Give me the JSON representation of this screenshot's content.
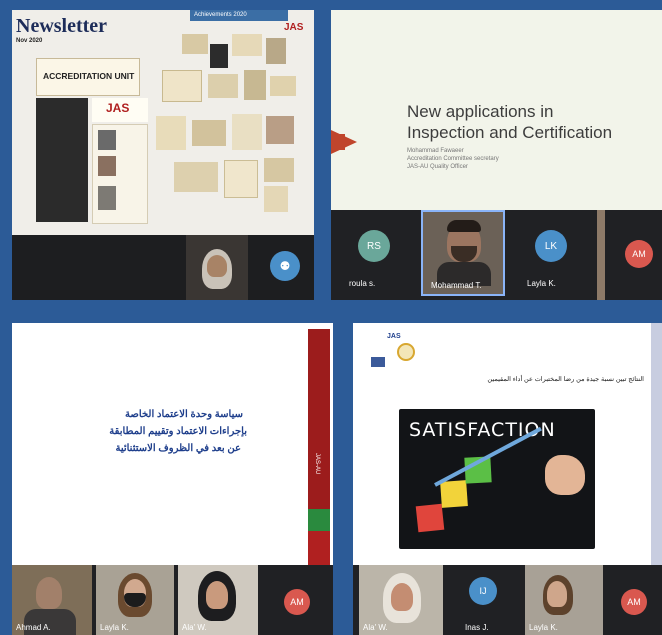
{
  "p1": {
    "title": "Newsletter",
    "subtitle": "Nov 2020",
    "unit": "ACCREDITATION UNIT",
    "logo": "JAS",
    "top_bar_text": "Achievements 2020",
    "logo2": "JAS"
  },
  "p2": {
    "title_line1": "New applications in",
    "title_line2": "Inspection and Certification",
    "sub1": "Mohammad Fawaeer",
    "sub2": "Accreditation Committee secretary",
    "sub3": "JAS-AU Quality Officer",
    "participants": [
      {
        "initials": "RS",
        "name": "roula s."
      },
      {
        "initials": "",
        "name": "Mohammad T."
      },
      {
        "initials": "LK",
        "name": "Layla K."
      },
      {
        "initials": "AM",
        "name": ""
      }
    ]
  },
  "p3": {
    "line1": "سياسة وحدة الاعتماد الخاصة",
    "line2": "بإجراءات الاعتماد وتقييم المطابقة",
    "line3": "عن بعد في الظروف الاستثنائية",
    "side_label": "JAS-AU",
    "participants": [
      "Ahmad A.",
      "Layla K.",
      "Ala' W."
    ],
    "avatar": "AM"
  },
  "p4": {
    "logo": "JAS",
    "bullet": "النتائج تبين نسبة جيدة من رضا المختبرات عن أداء المقيمين",
    "banner": "SATISFACTION",
    "participants": [
      "Ala' W.",
      "Inas J.",
      "Layla K."
    ],
    "avatar_ij": "IJ",
    "avatar_am": "AM"
  },
  "colors": {
    "avatar_green": "#6aa79a",
    "avatar_blue": "#4a90c9",
    "avatar_red": "#d9584f"
  }
}
